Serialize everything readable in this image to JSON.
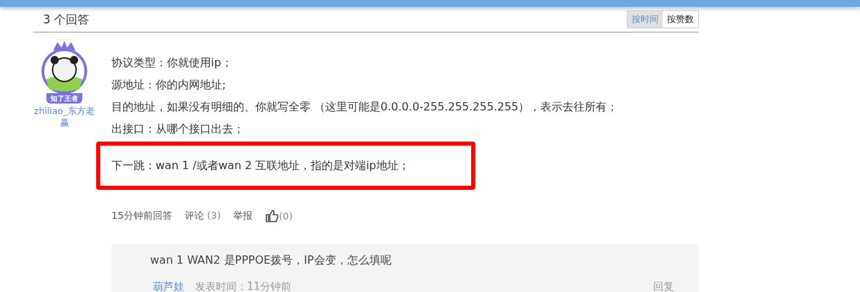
{
  "header": {
    "title": "3 个回答",
    "sort_tabs": [
      {
        "label": "按时间",
        "selected": true
      },
      {
        "label": "按赞数",
        "selected": false
      }
    ]
  },
  "answer": {
    "author": "zhiliao_东方老赢",
    "badge": "知了王者",
    "lines": [
      "协议类型：你就使用ip；",
      "源地址：你的内网地址;",
      "目的地址，如果没有明细的、你就写全零 （这里可能是0.0.0.0-255.255.255.255），表示去往所有；",
      "出接口：从哪个接口出去；"
    ],
    "highlighted_line": "下一跳：wan 1 /或者wan 2 互联地址，指的是对端ip地址；",
    "time": "15分钟前回答",
    "comment_label": "评论",
    "comment_count": "(3)",
    "report": "举报",
    "likes": "(0)"
  },
  "comment": {
    "text": "wan 1 WAN2 是PPPOE拨号，IP会变，怎么填呢",
    "author": "葫芦娃",
    "time": "发表时间：11分钟前",
    "reply": "回复"
  }
}
